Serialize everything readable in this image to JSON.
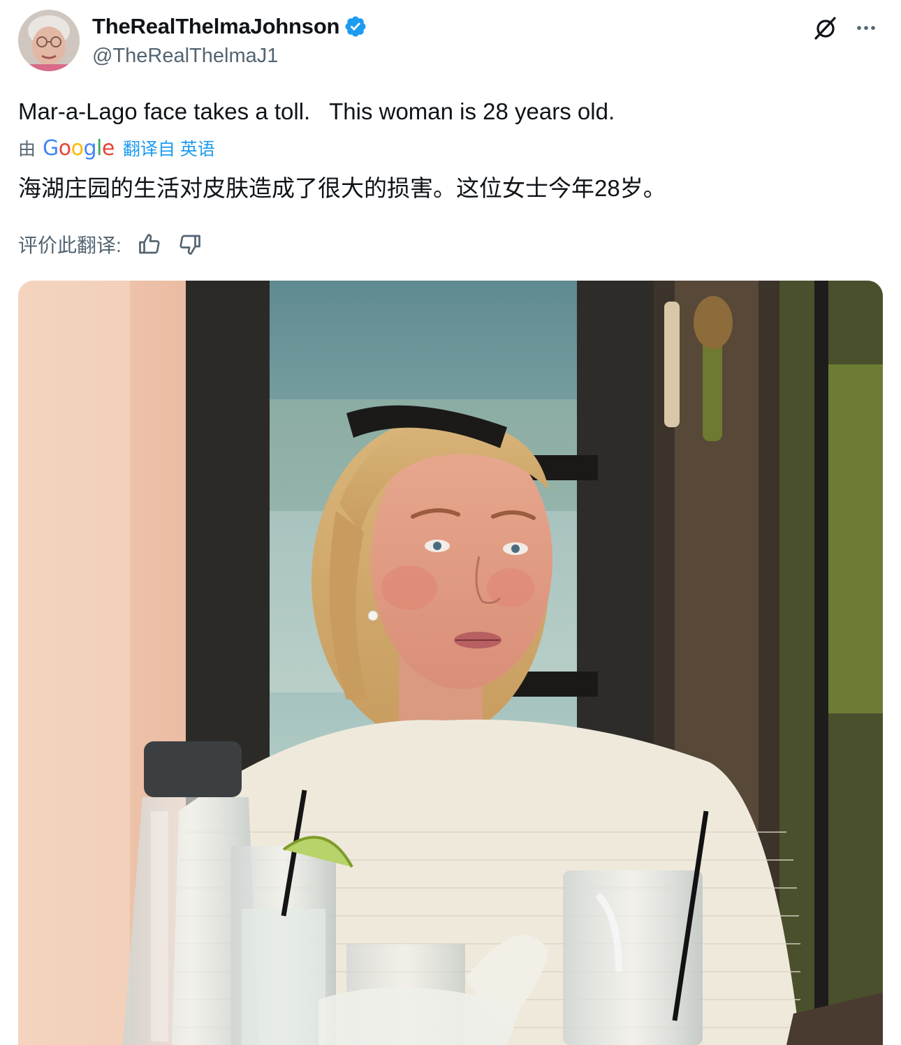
{
  "post": {
    "author": {
      "display_name": "TheRealThelmaJohnson",
      "handle": "@TheRealThelmaJ1",
      "verified": true
    },
    "text": "Mar-a-Lago face takes a toll.   This woman is 28 years old.",
    "translation": {
      "prefix": "由",
      "provider": "Google",
      "translated_from": "翻译自 英语",
      "text": "海湖庄园的生活对皮肤造成了很大的损害。这位女士今年28岁。",
      "rate_label": "评价此翻译:"
    }
  },
  "icons": {
    "verified": "verified-badge-icon",
    "grok": "grok-icon",
    "more": "more-options-icon",
    "thumbs_up": "thumbs-up-icon",
    "thumbs_down": "thumbs-down-icon"
  },
  "colors": {
    "text_primary": "#0f1419",
    "text_secondary": "#536471",
    "accent_blue": "#1d9bf0",
    "google_blue": "#4285f4",
    "google_red": "#ea4335",
    "google_yellow": "#fbbc05",
    "google_green": "#34a853"
  }
}
